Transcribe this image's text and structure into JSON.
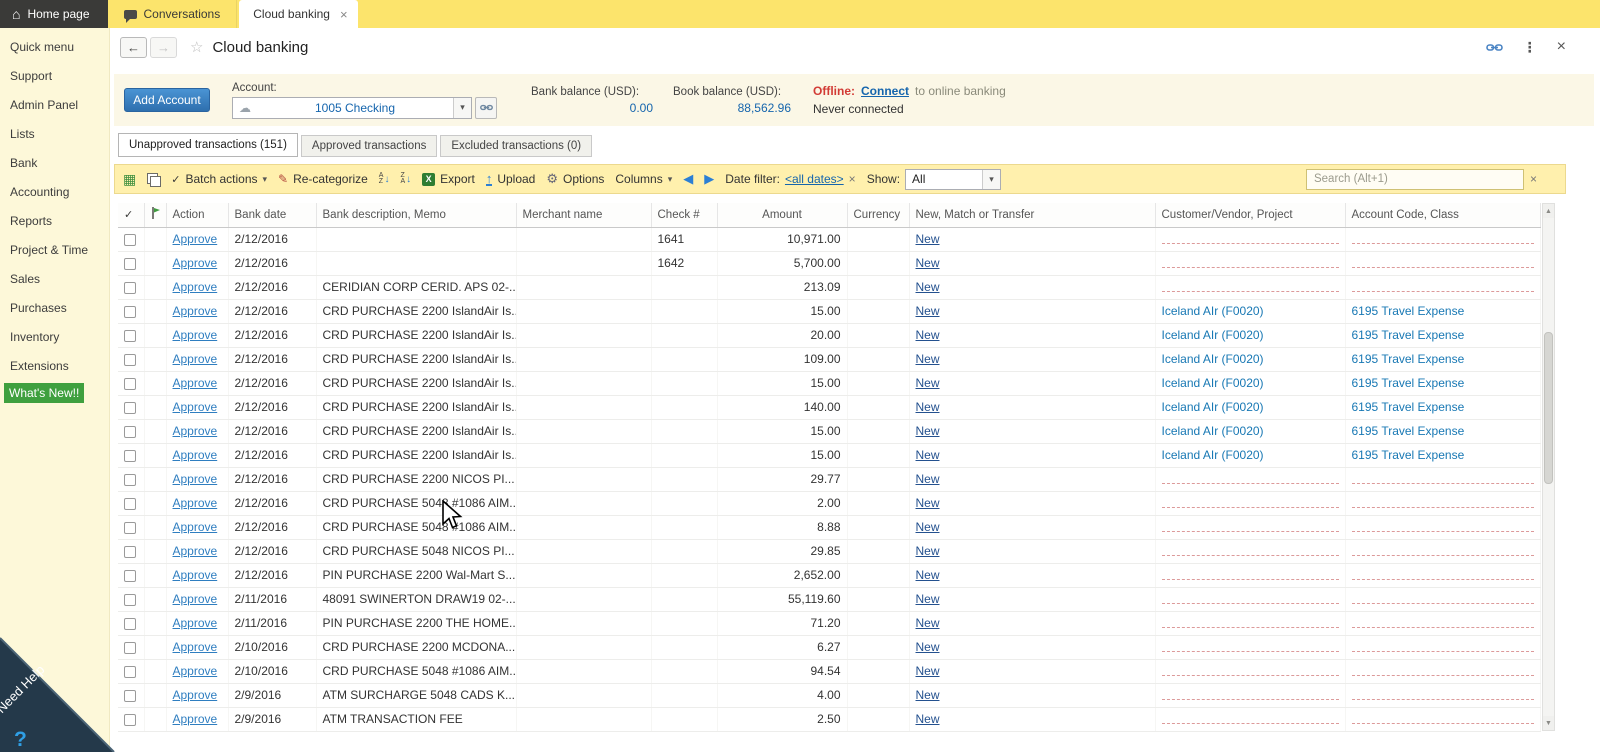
{
  "topbar": {
    "home_tab": "Home page",
    "conversations_tab": "Conversations",
    "cloud_tab": "Cloud banking"
  },
  "sidebar": {
    "items": [
      {
        "label": "Quick menu"
      },
      {
        "label": "Support"
      },
      {
        "label": "Admin Panel"
      },
      {
        "label": "Lists"
      },
      {
        "label": "Bank"
      },
      {
        "label": "Accounting"
      },
      {
        "label": "Reports"
      },
      {
        "label": "Project & Time"
      },
      {
        "label": "Sales"
      },
      {
        "label": "Purchases"
      },
      {
        "label": "Inventory"
      },
      {
        "label": "Extensions"
      }
    ],
    "whats_new_label": "What's New!!",
    "need_help_label": "Need Help"
  },
  "header": {
    "title": "Cloud banking"
  },
  "account_bar": {
    "add_account_label": "Add Account",
    "account_label": "Account:",
    "account_value": "1005 Checking",
    "bank_balance_label": "Bank balance (USD):",
    "bank_balance_value": "0.00",
    "book_balance_label": "Book balance (USD):",
    "book_balance_value": "88,562.96",
    "offline_label": "Offline:",
    "connect_label": "Connect",
    "connect_suffix": "to online banking",
    "connection_status": "Never connected"
  },
  "view_tabs": [
    {
      "label": "Unapproved transactions (151)",
      "active": true
    },
    {
      "label": "Approved transactions",
      "active": false
    },
    {
      "label": "Excluded transactions (0)",
      "active": false
    }
  ],
  "toolbar": {
    "batch_actions_label": "Batch actions",
    "recategorize_label": "Re-categorize",
    "export_label": "Export",
    "upload_label": "Upload",
    "options_label": "Options",
    "columns_label": "Columns",
    "date_filter_label": "Date filter:",
    "date_filter_value": "<all dates>",
    "show_label": "Show:",
    "show_value": "All",
    "search_placeholder": "Search (Alt+1)"
  },
  "table": {
    "columns": {
      "action": "Action",
      "bank_date": "Bank date",
      "description": "Bank description, Memo",
      "merchant": "Merchant name",
      "check": "Check #",
      "amount": "Amount",
      "currency": "Currency",
      "match": "New, Match or Transfer",
      "customer": "Customer/Vendor, Project",
      "account": "Account Code, Class"
    },
    "rows": [
      {
        "action": "Approve",
        "date": "2/12/2016",
        "desc": "",
        "merchant": "",
        "check": "1641",
        "amount": "10,971.00",
        "currency": "",
        "match": "New",
        "customer": "",
        "account": ""
      },
      {
        "action": "Approve",
        "date": "2/12/2016",
        "desc": "",
        "merchant": "",
        "check": "1642",
        "amount": "5,700.00",
        "currency": "",
        "match": "New",
        "customer": "",
        "account": ""
      },
      {
        "action": "Approve",
        "date": "2/12/2016",
        "desc": "CERIDIAN CORP CERID. APS 02-...",
        "merchant": "",
        "check": "",
        "amount": "213.09",
        "currency": "",
        "match": "New",
        "customer": "",
        "account": ""
      },
      {
        "action": "Approve",
        "date": "2/12/2016",
        "desc": "CRD PURCHASE 2200 IslandAir Is...",
        "merchant": "",
        "check": "",
        "amount": "15.00",
        "currency": "",
        "match": "New",
        "customer": "Iceland AIr (F0020)",
        "account": "6195 Travel Expense"
      },
      {
        "action": "Approve",
        "date": "2/12/2016",
        "desc": "CRD PURCHASE 2200 IslandAir Is...",
        "merchant": "",
        "check": "",
        "amount": "20.00",
        "currency": "",
        "match": "New",
        "customer": "Iceland AIr (F0020)",
        "account": "6195 Travel Expense"
      },
      {
        "action": "Approve",
        "date": "2/12/2016",
        "desc": "CRD PURCHASE 2200 IslandAir Is...",
        "merchant": "",
        "check": "",
        "amount": "109.00",
        "currency": "",
        "match": "New",
        "customer": "Iceland AIr (F0020)",
        "account": "6195 Travel Expense"
      },
      {
        "action": "Approve",
        "date": "2/12/2016",
        "desc": "CRD PURCHASE 2200 IslandAir Is...",
        "merchant": "",
        "check": "",
        "amount": "15.00",
        "currency": "",
        "match": "New",
        "customer": "Iceland AIr (F0020)",
        "account": "6195 Travel Expense"
      },
      {
        "action": "Approve",
        "date": "2/12/2016",
        "desc": "CRD PURCHASE 2200 IslandAir Is...",
        "merchant": "",
        "check": "",
        "amount": "140.00",
        "currency": "",
        "match": "New",
        "customer": "Iceland AIr (F0020)",
        "account": "6195 Travel Expense"
      },
      {
        "action": "Approve",
        "date": "2/12/2016",
        "desc": "CRD PURCHASE 2200 IslandAir Is...",
        "merchant": "",
        "check": "",
        "amount": "15.00",
        "currency": "",
        "match": "New",
        "customer": "Iceland AIr (F0020)",
        "account": "6195 Travel Expense"
      },
      {
        "action": "Approve",
        "date": "2/12/2016",
        "desc": "CRD PURCHASE 2200 IslandAir Is...",
        "merchant": "",
        "check": "",
        "amount": "15.00",
        "currency": "",
        "match": "New",
        "customer": "Iceland AIr (F0020)",
        "account": "6195 Travel Expense"
      },
      {
        "action": "Approve",
        "date": "2/12/2016",
        "desc": "CRD PURCHASE 2200 NICOS PI...",
        "merchant": "",
        "check": "",
        "amount": "29.77",
        "currency": "",
        "match": "New",
        "customer": "",
        "account": ""
      },
      {
        "action": "Approve",
        "date": "2/12/2016",
        "desc": "CRD PURCHASE 5048 #1086 AIM...",
        "merchant": "",
        "check": "",
        "amount": "2.00",
        "currency": "",
        "match": "New",
        "customer": "",
        "account": ""
      },
      {
        "action": "Approve",
        "date": "2/12/2016",
        "desc": "CRD PURCHASE 5048 #1086 AIM...",
        "merchant": "",
        "check": "",
        "amount": "8.88",
        "currency": "",
        "match": "New",
        "customer": "",
        "account": ""
      },
      {
        "action": "Approve",
        "date": "2/12/2016",
        "desc": "CRD PURCHASE 5048 NICOS PI...",
        "merchant": "",
        "check": "",
        "amount": "29.85",
        "currency": "",
        "match": "New",
        "customer": "",
        "account": ""
      },
      {
        "action": "Approve",
        "date": "2/12/2016",
        "desc": "PIN PURCHASE 2200 Wal-Mart S...",
        "merchant": "",
        "check": "",
        "amount": "2,652.00",
        "currency": "",
        "match": "New",
        "customer": "",
        "account": ""
      },
      {
        "action": "Approve",
        "date": "2/11/2016",
        "desc": "48091 SWINERTON DRAW19 02-...",
        "merchant": "",
        "check": "",
        "amount": "55,119.60",
        "currency": "",
        "match": "New",
        "customer": "",
        "account": ""
      },
      {
        "action": "Approve",
        "date": "2/11/2016",
        "desc": "PIN PURCHASE 2200 THE HOME...",
        "merchant": "",
        "check": "",
        "amount": "71.20",
        "currency": "",
        "match": "New",
        "customer": "",
        "account": ""
      },
      {
        "action": "Approve",
        "date": "2/10/2016",
        "desc": "CRD PURCHASE 2200 MCDONA...",
        "merchant": "",
        "check": "",
        "amount": "6.27",
        "currency": "",
        "match": "New",
        "customer": "",
        "account": ""
      },
      {
        "action": "Approve",
        "date": "2/10/2016",
        "desc": "CRD PURCHASE 5048 #1086 AIM...",
        "merchant": "",
        "check": "",
        "amount": "94.54",
        "currency": "",
        "match": "New",
        "customer": "",
        "account": ""
      },
      {
        "action": "Approve",
        "date": "2/9/2016",
        "desc": "ATM SURCHARGE 5048 CADS K...",
        "merchant": "",
        "check": "",
        "amount": "4.00",
        "currency": "",
        "match": "New",
        "customer": "",
        "account": ""
      },
      {
        "action": "Approve",
        "date": "2/9/2016",
        "desc": "ATM TRANSACTION FEE",
        "merchant": "",
        "check": "",
        "amount": "2.50",
        "currency": "",
        "match": "New",
        "customer": "",
        "account": ""
      }
    ]
  },
  "icons": {
    "home_glyph": "⌂",
    "back_glyph": "←",
    "forward_glyph": "→",
    "star_glyph": "☆",
    "kebab_glyph": "⋮",
    "close_glyph": "×",
    "cloud_glyph": "☁",
    "caret_glyph": "▾",
    "check_glyph": "✓",
    "gear_glyph": "⚙",
    "pencil_glyph": "✎",
    "left_arrow_glyph": "◀",
    "right_arrow_glyph": "▶",
    "upload_glyph": "↑",
    "grid_glyph": "▦",
    "excel_glyph": "X",
    "sort_a": "A",
    "sort_z": "Z",
    "sort_arrow": "↓",
    "up_glyph": "▲",
    "down_glyph": "▼",
    "question_glyph": "?"
  },
  "colors": {
    "accent_yellow": "#fce46c",
    "toolbar_yellow": "#fff0ad",
    "sidebar_yellow": "#fdf8d9",
    "link_blue": "#2f7ec0",
    "value_blue": "#1565ad",
    "offline_red": "#d23b35",
    "whats_new_green": "#3fa03f",
    "add_button_blue": "#3579ba"
  }
}
